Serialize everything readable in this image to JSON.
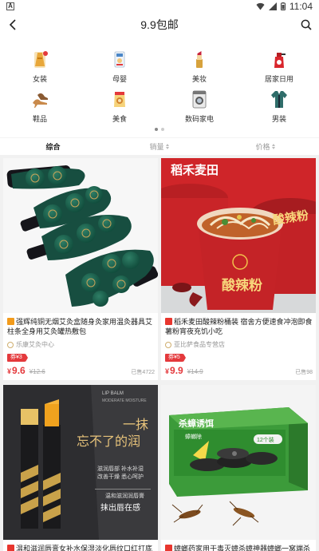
{
  "status_bar": {
    "time": "11:04"
  },
  "header": {
    "title": "9.9包邮"
  },
  "categories": [
    {
      "label": "女装",
      "icon": "dress-icon"
    },
    {
      "label": "母婴",
      "icon": "baby-formula-icon"
    },
    {
      "label": "美妆",
      "icon": "lipstick-icon"
    },
    {
      "label": "居家日用",
      "icon": "spray-bottle-icon"
    },
    {
      "label": "鞋品",
      "icon": "heels-icon"
    },
    {
      "label": "美食",
      "icon": "snack-bag-icon"
    },
    {
      "label": "数码家电",
      "icon": "washing-machine-icon"
    },
    {
      "label": "男装",
      "icon": "shirt-icon"
    }
  ],
  "sort_tabs": [
    {
      "label": "综合",
      "active": true
    },
    {
      "label": "销量",
      "active": false
    },
    {
      "label": "价格",
      "active": false
    }
  ],
  "products": [
    {
      "title": "强辉纯铜无烟艾灸盒随身灸家用温灸器具艾柱条全身用艾灸罐热敷包",
      "shop": "乐康艾灸中心",
      "coupon": "券¥3",
      "price": "9.6",
      "price_yen": "¥",
      "original_price": "¥12.6",
      "sold": "已售4722",
      "platform": "tmall"
    },
    {
      "title": "稻禾麦田酸辣粉桶装 宿舍方便速食冲泡即食薯粉宵夜充饥小吃",
      "shop": "亚比萨食品专营店",
      "coupon": "券¥5",
      "price": "9.9",
      "price_yen": "¥",
      "original_price": "¥14.9",
      "sold": "已售98",
      "platform": "tb",
      "image_text": {
        "brand": "稻禾麦田",
        "product": "酸辣粉",
        "lid": "酸辣粉"
      }
    },
    {
      "title": "温和滋润唇膏女补水保湿淡化唇纹口红打底",
      "platform": "tb",
      "image_text": {
        "brand": "LIP BALM",
        "subtitle": "MODERATE MOISTURE",
        "slogan_1": "一抹",
        "slogan_2": "忘不了的润",
        "point_1": "滋润唇部 补水补湿",
        "point_2": "改善干燥 悉心呵护",
        "point_3": "温和滋润润唇膏",
        "cta": "抹出唇在感"
      }
    },
    {
      "title": "蟑螂药家用干毒灭蟑杀蟑神器蟑螂一窝端杀",
      "platform": "tb",
      "image_text": {
        "product": "杀蟑诱饵",
        "sub": "蟑螂除",
        "count": "12个装"
      }
    }
  ],
  "colors": {
    "accent_red": "#e4393c",
    "background": "#f1f1f1",
    "card_bg": "#ffffff"
  }
}
